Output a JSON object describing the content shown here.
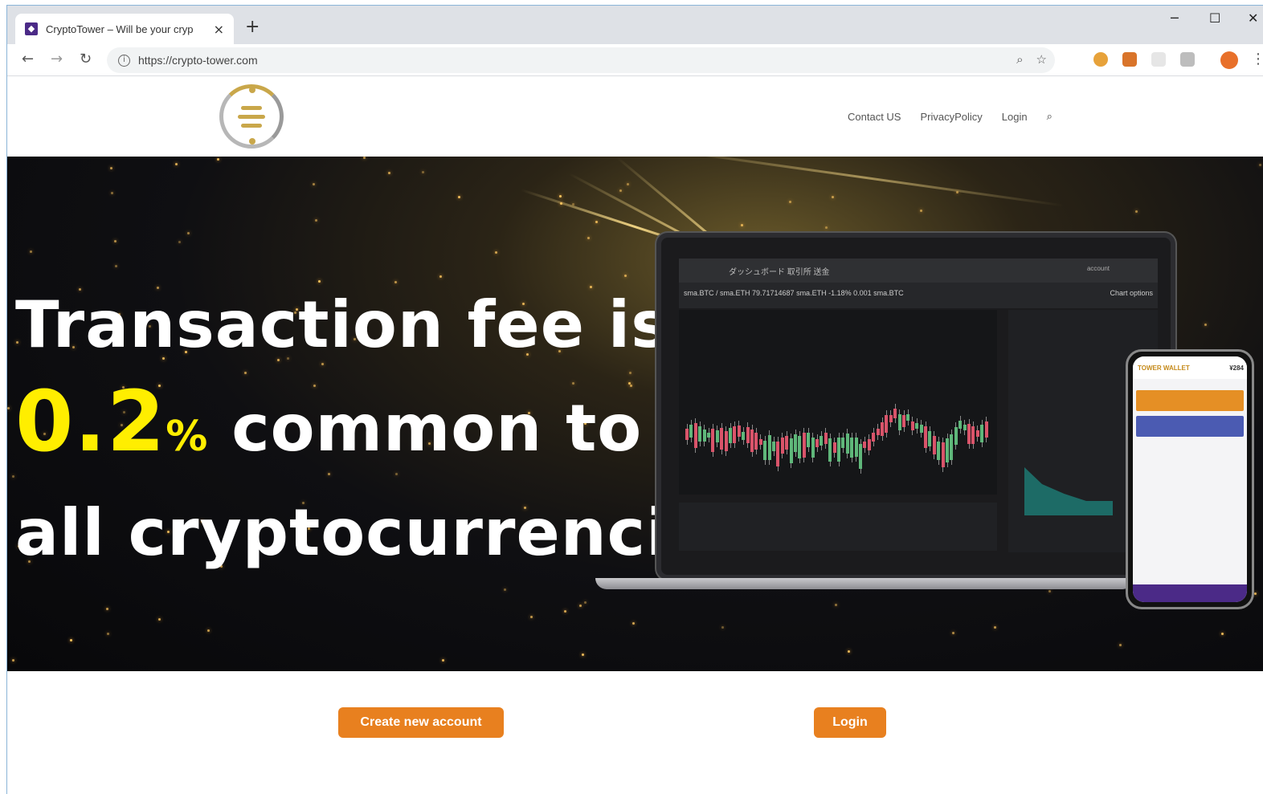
{
  "browser": {
    "tab_title": "CryptoTower – Will be your cryp",
    "favicon_glyph": "◆",
    "close_glyph": "×",
    "newtab_glyph": "+",
    "url": "https://crypto-tower.com",
    "icons": [
      "back-icon",
      "forward-icon",
      "reload-icon",
      "info-icon",
      "zoom-icon",
      "star-icon",
      "extension-icon",
      "profile-icon",
      "menu-icon"
    ]
  },
  "site": {
    "nav": [
      "Contact US",
      "PrivacyPolicy",
      "Login"
    ],
    "search_icon": "search-icon"
  },
  "hero": {
    "line1": "Transaction fee is",
    "number": "0.2",
    "percent": "%",
    "line2_rest": " common to",
    "line3": "all cryptocurrencies!"
  },
  "laptop": {
    "menu": "ダッシュボード   取引所   送金",
    "pair": "sma.BTC / sma.ETH      79.71714687 sma.ETH     -1.18%      0.001 sma.BTC",
    "chart_options": "Chart options",
    "account": "account"
  },
  "phone": {
    "brand": "TOWER WALLET",
    "balance": "¥284"
  },
  "actions": {
    "create_account": "Create new account",
    "login": "Login"
  },
  "colors": {
    "accent_orange": "#e8801f",
    "hero_yellow": "#ffee00",
    "brand_purple": "#4b2a87"
  }
}
